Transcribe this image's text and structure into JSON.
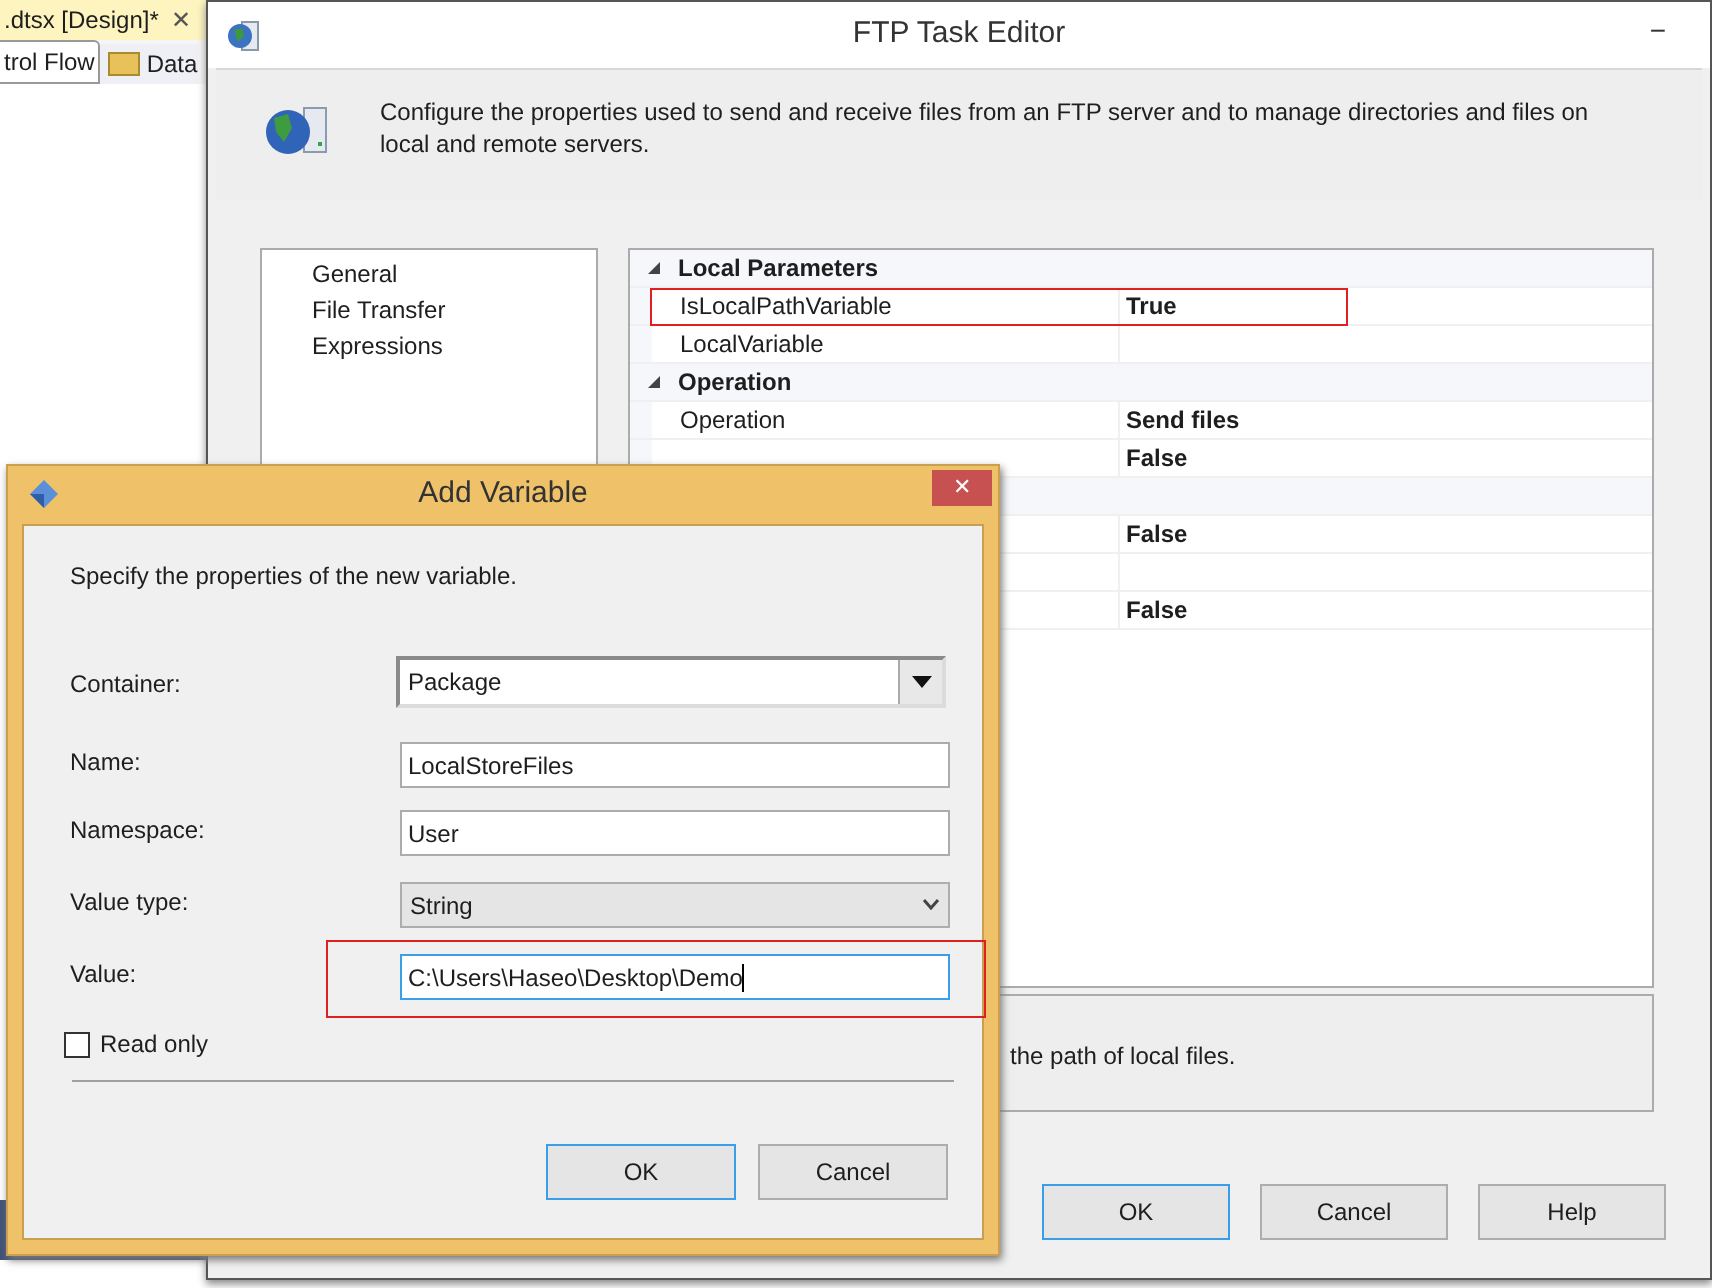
{
  "background_window": {
    "document_tab": ".dtsx [Design]*",
    "close": "✕",
    "tabs": [
      {
        "label": "trol Flow",
        "selected": true
      },
      {
        "label": "Data",
        "selected": false
      }
    ]
  },
  "ftp_editor": {
    "title": "FTP Task Editor",
    "minimize": "−",
    "description": "Configure the properties used to send and receive files from an FTP server and to manage directories and files on local and remote servers.",
    "pages": [
      "General",
      "File Transfer",
      "Expressions"
    ],
    "properties": [
      {
        "kind": "category",
        "label": "Local Parameters",
        "expanded": true
      },
      {
        "kind": "property",
        "name": "IsLocalPathVariable",
        "value": "True",
        "highlighted": true
      },
      {
        "kind": "property",
        "name": "LocalVariable"
      },
      {
        "kind": "category",
        "label": "Operation",
        "expanded": true
      },
      {
        "kind": "property",
        "name": "Operation",
        "value": "Send files"
      },
      {
        "kind": "property",
        "value": "False"
      },
      {
        "kind": "category"
      },
      {
        "kind": "property",
        "value": "False"
      },
      {
        "kind": "property"
      },
      {
        "kind": "property",
        "value": "False"
      }
    ],
    "help_text": "the path of local files.",
    "buttons": [
      "OK",
      "Cancel",
      "Help"
    ]
  },
  "add_variable": {
    "title": "Add Variable",
    "close": "✕",
    "instruction": "Specify the properties of the new variable.",
    "fields": [
      {
        "kind": "dropdown",
        "label": "Container:",
        "value": "Package"
      },
      {
        "kind": "text",
        "label": "Name:",
        "value": "LocalStoreFiles"
      },
      {
        "kind": "text",
        "label": "Namespace:",
        "value": "User"
      },
      {
        "kind": "select",
        "label": "Value type:",
        "value": "String"
      },
      {
        "kind": "text",
        "label": "Value:",
        "value": "C:\\Users\\Haseo\\Desktop\\Demo",
        "highlighted": true
      }
    ],
    "read_only": {
      "label": "Read only",
      "checked": false
    },
    "buttons": [
      "OK",
      "Cancel"
    ]
  }
}
